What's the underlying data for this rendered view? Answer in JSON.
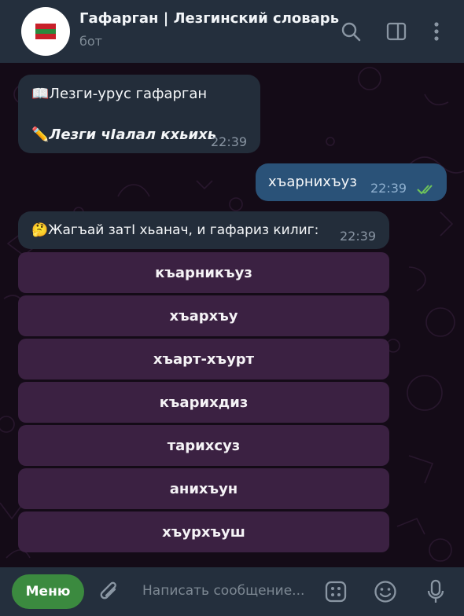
{
  "header": {
    "title": "Гафарган | Лезгинский словарь",
    "subtitle": "бот",
    "icons": [
      "search-icon",
      "sidebar-toggle-icon",
      "more-vertical-icon"
    ]
  },
  "messages": [
    {
      "line1": "📖Лезги-урус гафарган",
      "line2": "✏️",
      "line2_italic": "Лезги чӀалал кхьихь",
      "time": "22:39"
    },
    {
      "text": "хъарнихъуз",
      "time": "22:39",
      "status_icon": "double-check-icon"
    },
    {
      "text": "🤔Жагъай затӀ хьанач, и гафариз килиг:",
      "time": "22:39"
    }
  ],
  "keyboard": [
    "къарникъуз",
    "хъархъу",
    "хъарт-хъурт",
    "къарихдиз",
    "тарихсуз",
    "анихъун",
    "хъурхъуш"
  ],
  "bottom": {
    "menu_label": "Меню",
    "input_placeholder": "Написать сообщение...",
    "icons": [
      "attach-icon",
      "bot-commands-icon",
      "emoji-icon",
      "microphone-icon"
    ]
  },
  "colors": {
    "header_bg": "#242f3d",
    "incoming_bubble": "#232d3a",
    "outgoing_bubble": "#2a5278",
    "keyboard_button": "#3b2142",
    "menu_button": "#3b8a3f",
    "read_check": "#6ec45a"
  }
}
